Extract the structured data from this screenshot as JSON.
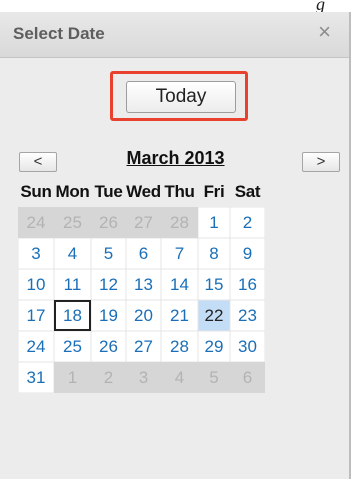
{
  "top_fragment": "g",
  "dialog": {
    "title": "Select Date",
    "close_glyph": "×",
    "today_label": "Today",
    "prev_glyph": "<",
    "next_glyph": ">",
    "month_label": "March 2013"
  },
  "calendar": {
    "weekdays": [
      "Sun",
      "Mon",
      "Tue",
      "Wed",
      "Thu",
      "Fri",
      "Sat"
    ],
    "weeks": [
      [
        {
          "d": "24",
          "muted": true
        },
        {
          "d": "25",
          "muted": true
        },
        {
          "d": "26",
          "muted": true
        },
        {
          "d": "27",
          "muted": true
        },
        {
          "d": "28",
          "muted": true
        },
        {
          "d": "1"
        },
        {
          "d": "2"
        }
      ],
      [
        {
          "d": "3"
        },
        {
          "d": "4"
        },
        {
          "d": "5"
        },
        {
          "d": "6"
        },
        {
          "d": "7"
        },
        {
          "d": "8"
        },
        {
          "d": "9"
        }
      ],
      [
        {
          "d": "10"
        },
        {
          "d": "11"
        },
        {
          "d": "12"
        },
        {
          "d": "13"
        },
        {
          "d": "14"
        },
        {
          "d": "15"
        },
        {
          "d": "16"
        }
      ],
      [
        {
          "d": "17"
        },
        {
          "d": "18",
          "today": true
        },
        {
          "d": "19"
        },
        {
          "d": "20"
        },
        {
          "d": "21"
        },
        {
          "d": "22",
          "selected": true
        },
        {
          "d": "23"
        }
      ],
      [
        {
          "d": "24"
        },
        {
          "d": "25"
        },
        {
          "d": "26"
        },
        {
          "d": "27"
        },
        {
          "d": "28"
        },
        {
          "d": "29"
        },
        {
          "d": "30"
        }
      ],
      [
        {
          "d": "31"
        },
        {
          "d": "1",
          "muted": true
        },
        {
          "d": "2",
          "muted": true
        },
        {
          "d": "3",
          "muted": true
        },
        {
          "d": "4",
          "muted": true
        },
        {
          "d": "5",
          "muted": true
        },
        {
          "d": "6",
          "muted": true
        }
      ]
    ]
  },
  "colors": {
    "highlight_box": "#e8412d",
    "day_link": "#1a6fb8",
    "selected_day_bg": "#c4ddf6",
    "muted_day_bg": "#d6d6d6"
  }
}
